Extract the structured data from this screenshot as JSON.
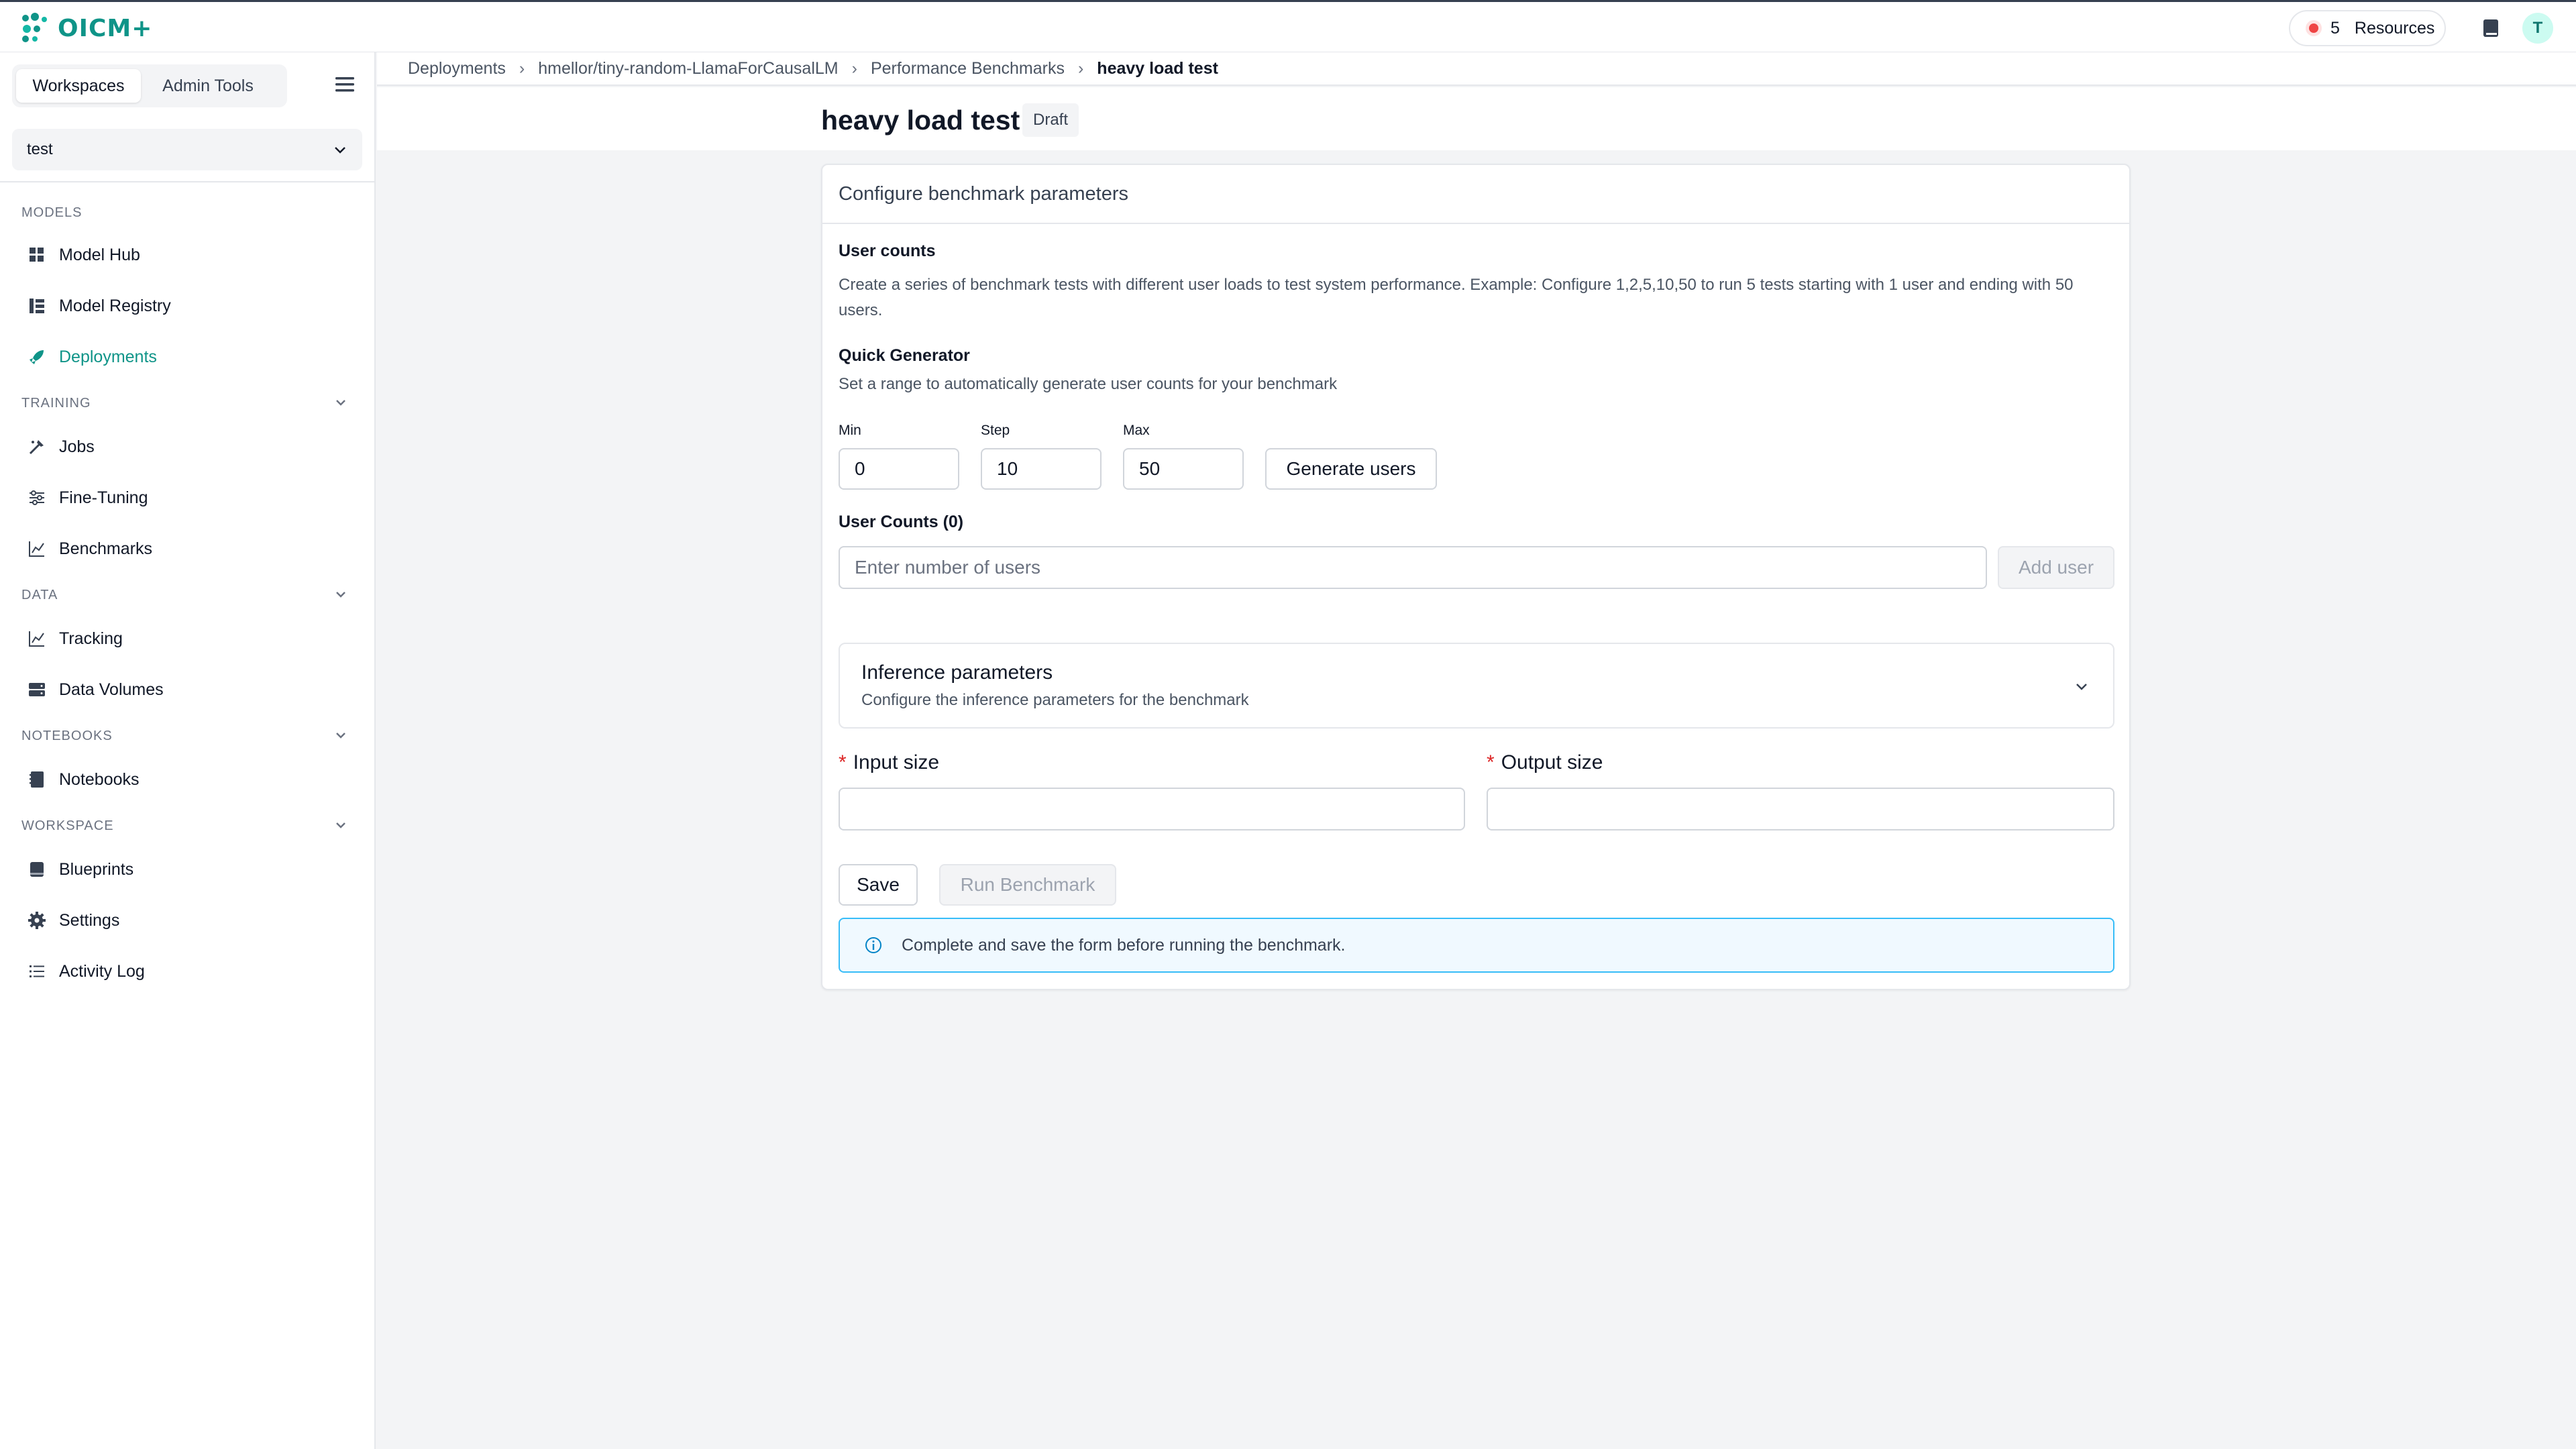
{
  "app": {
    "logo_text": "OICM+",
    "brand_color": "#0f9488",
    "resources_count": "5",
    "resources_label": "Resources",
    "avatar_initial": "T"
  },
  "sidebar": {
    "tabs": [
      {
        "label": "Workspaces",
        "active": true
      },
      {
        "label": "Admin Tools",
        "active": false
      }
    ],
    "workspace_select": "test",
    "sections": {
      "models": "MODELS",
      "training": "TRAINING",
      "data": "DATA",
      "notebooks": "NOTEBOOKS",
      "workspace": "WORKSPACE"
    },
    "items": {
      "model_hub": "Model Hub",
      "model_registry": "Model Registry",
      "deployments": "Deployments",
      "jobs": "Jobs",
      "fine_tuning": "Fine-Tuning",
      "benchmarks": "Benchmarks",
      "tracking": "Tracking",
      "data_volumes": "Data Volumes",
      "notebooks": "Notebooks",
      "blueprints": "Blueprints",
      "settings": "Settings",
      "activity_log": "Activity Log"
    }
  },
  "breadcrumb": {
    "items": [
      "Deployments",
      "hmellor/tiny-random-LlamaForCausalLM",
      "Performance Benchmarks",
      "heavy load test"
    ]
  },
  "page": {
    "title": "heavy load test",
    "badge": "Draft"
  },
  "form": {
    "card_title": "Configure benchmark parameters",
    "user_counts_title": "User counts",
    "user_counts_help": "Create a series of benchmark tests with different user loads to test system performance. Example: Configure 1,2,5,10,50 to run 5 tests starting with 1 user and ending with 50 users.",
    "quick_generator_title": "Quick Generator",
    "quick_generator_help": "Set a range to automatically generate user counts for your benchmark",
    "min_label": "Min",
    "min_value": "0",
    "step_label": "Step",
    "step_value": "10",
    "max_label": "Max",
    "max_value": "50",
    "generate_button": "Generate users",
    "user_counts_list_label": "User Counts (0)",
    "user_input_placeholder": "Enter number of users",
    "add_user_button": "Add user",
    "inference_title": "Inference parameters",
    "inference_subtitle": "Configure the inference parameters for the benchmark",
    "input_size_label": "Input size",
    "output_size_label": "Output size",
    "required_marker": "*",
    "save_button": "Save",
    "run_button": "Run Benchmark",
    "info_message": "Complete and save the form before running the benchmark."
  }
}
